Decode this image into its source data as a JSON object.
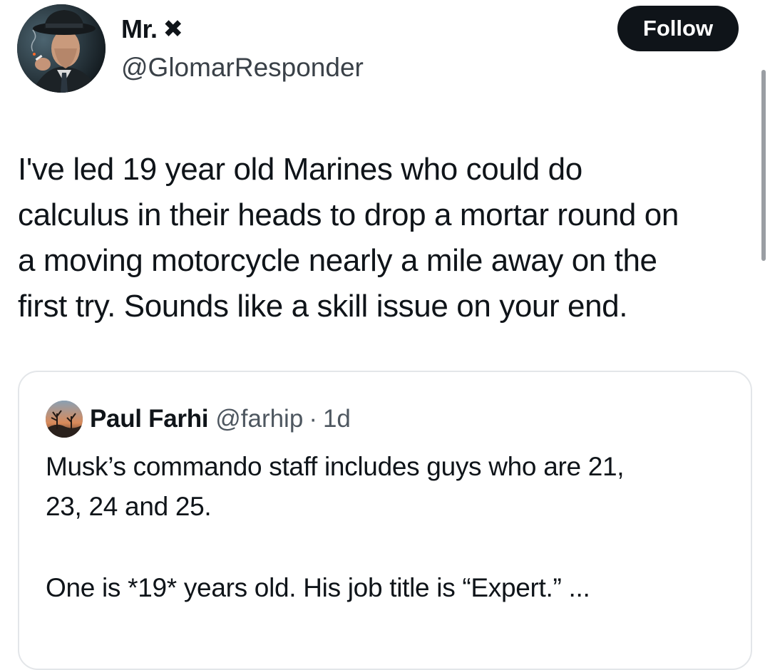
{
  "author": {
    "name": "Mr.",
    "badge": "✖",
    "handle": "@GlomarResponder"
  },
  "follow_label": "Follow",
  "post": {
    "lines": [
      "I've led 19 year old Marines who could do",
      "calculus in their heads to drop a mortar round on",
      "a moving motorcycle nearly a mile away on the",
      "first try. Sounds like a skill issue on your end."
    ]
  },
  "quote": {
    "name": "Paul Farhi",
    "handle": "@farhip",
    "separator": "·",
    "time": "1d",
    "paragraph1_lines": [
      "Musk’s commando staff includes guys who are 21,",
      "23, 24 and 25."
    ],
    "paragraph2": "One is *19* years old. His job title is “Expert.” ..."
  },
  "colors": {
    "text": "#0f1419",
    "secondary": "#3a4148",
    "button_bg": "#0f1419",
    "card_border": "#e3e6e9"
  }
}
